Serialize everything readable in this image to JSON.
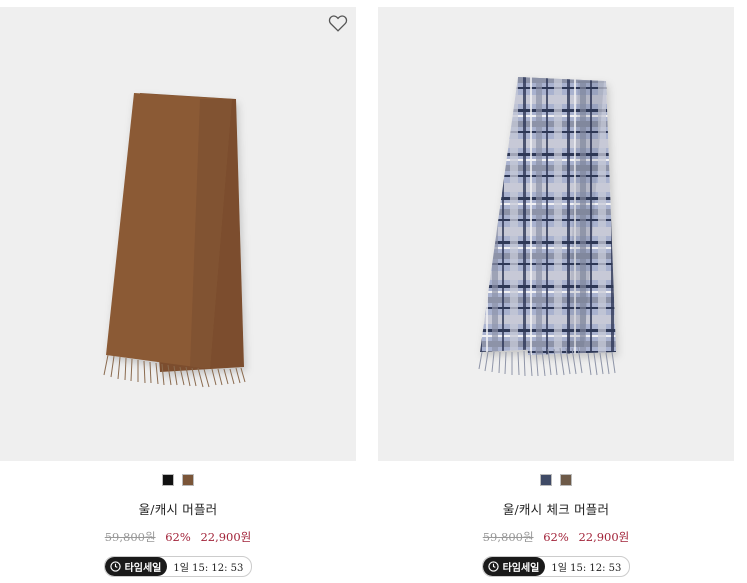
{
  "products": [
    {
      "name": "울/캐시 머플러",
      "swatch_colors": [
        "#111111",
        "#7a5538"
      ],
      "original_price": "59,800원",
      "discount": "62%",
      "sale_price": "22,900원",
      "timer_label": "타임세일",
      "countdown": "1일 15: 12: 53",
      "wishlist_icon": "heart-icon",
      "image_color": "#8a5a36"
    },
    {
      "name": "울/캐시 체크 머플러",
      "swatch_colors": [
        "#3f4a66",
        "#6d5a48"
      ],
      "original_price": "59,800원",
      "discount": "62%",
      "sale_price": "22,900원",
      "timer_label": "타임세일",
      "countdown": "1일 15: 12: 53",
      "image_color": "#a9b2cf"
    }
  ]
}
